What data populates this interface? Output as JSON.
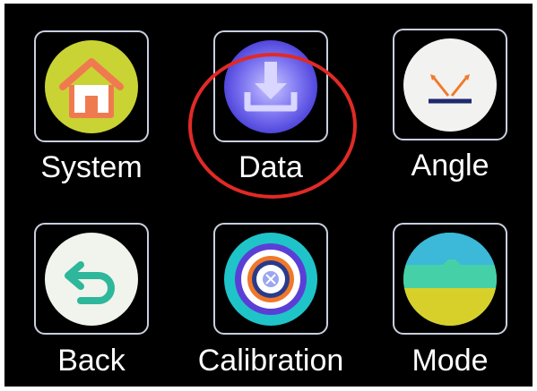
{
  "menu": {
    "items": [
      {
        "label": "System",
        "icon": "home-icon",
        "color": "#c9d334"
      },
      {
        "label": "Data",
        "icon": "download-icon",
        "color": "#5b55e6"
      },
      {
        "label": "Angle",
        "icon": "angle-icon",
        "color": "#f2f2f0"
      },
      {
        "label": "Back",
        "icon": "back-arrow-icon",
        "color": "#f0f4ec"
      },
      {
        "label": "Calibration",
        "icon": "target-icon",
        "color": "#1fc4c9"
      },
      {
        "label": "Mode",
        "icon": "mode-icon",
        "color": "#3cc7c7"
      }
    ],
    "selected": "Data",
    "highlight_color": "#e02a26"
  }
}
